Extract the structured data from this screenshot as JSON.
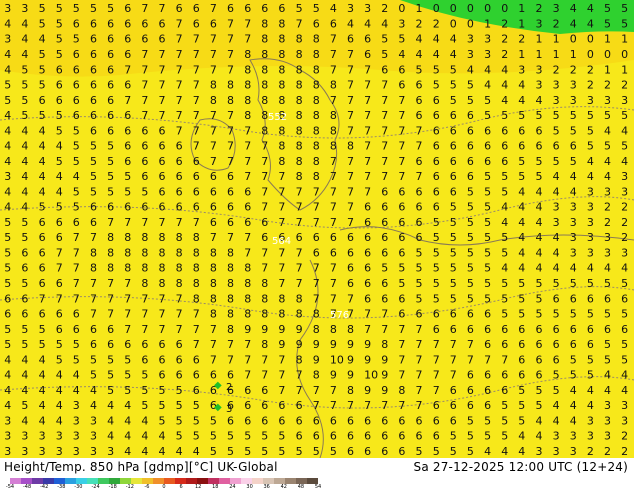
{
  "map": {
    "product": "Height/Temp. 850 hPa [gdmp][°C] UK-Global",
    "valid": "Sa 27-12-2025 12:00 UTC (12+24)",
    "field_colors": {
      "background": "#f7e81a",
      "upper_band": "#f6d615",
      "cold_edge": "#2fd12f",
      "label_text": "#111111",
      "contour": "#9a8a6a",
      "contour_alt": "#e0c7a0",
      "coast": "#8a7a55",
      "green_marker": "#1fbf2a"
    },
    "rows": [
      "3 3 5 5 5 5 5 6 7 7 6 6 7 6 6 6 6 5 5 4 3 3 2 0 1 0 0 0 0 0 1 2 3 4 4 5 5",
      "4 4 5 5 6 6 6 6 6 6 7 6 6 7 7 8 8 7 6 6 4 4 4 3 2 2 0 0 1 2 1 3 2 4 4 5 5",
      "3 4 4 5 5 6 6 6 6 6 7 7 7 7 7 8 8 8 8 7 6 6 5 5 4 4 4 3 3 2 2 1 1 0 0 1 1",
      "4 4 5 5 6 6 6 6 7 7 7 7 7 7 8 8 8 8 8 7 7 6 5 4 4 4 4 3 3 2 1 1 1 1 0 0 0",
      "4 5 5 6 6 6 6 7 7 7 7 7 7 7 8 8 8 8 8 7 7 7 6 6 5 5 5 4 4 4 3 3 2 2 2 1 1",
      "5 5 5 6 6 6 6 6 7 7 7 7 8 8 8 8 8 8 8 8 7 7 7 6 6 5 5 5 4 4 4 3 3 3 2 2 2",
      "5 5 6 6 6 6 6 7 7 7 7 7 8 8 8 8 8 8 8 7 7 7 7 7 6 6 5 5 5 4 4 4 3 3 3 3 3",
      "4 5 5 5 6 6 6 6 7 7 7 7 7 7 8 8 8 8 8 8 7 7 7 7 6 6 6 6 5 5 5 5 5 5 5 5 5",
      "4 4 4 5 5 6 6 6 6 6 7 7 7 7 7 8 8 8 8 8 7 7 7 7 7 6 6 6 6 6 6 6 5 5 5 4 4",
      "4 4 4 4 5 5 5 6 6 6 6 7 7 7 7 7 8 8 8 8 8 7 7 7 7 6 6 6 6 6 6 6 6 6 5 5 5",
      "4 4 4 5 5 5 5 6 6 6 6 6 7 7 7 7 8 8 8 7 7 7 7 7 6 6 6 6 6 6 5 5 5 5 4 4 4",
      "3 4 4 4 4 5 5 5 6 6 6 6 6 6 7 7 7 8 8 7 7 7 7 7 7 6 6 6 5 5 5 5 4 4 4 4 3",
      "4 4 4 4 5 5 5 5 5 6 6 6 6 6 6 7 7 7 7 7 7 7 6 6 6 6 6 5 5 5 4 4 4 4 3 3 3",
      "4 4 5 5 5 6 6 6 6 6 6 6 6 6 6 7 7 7 7 7 7 6 6 6 6 6 5 5 5 4 4 4 3 3 3 2 2",
      "5 5 6 6 6 6 7 7 7 7 7 7 6 6 6 6 7 7 7 7 7 6 6 6 6 5 5 5 5 4 4 4 3 3 3 2 2",
      "5 5 6 6 7 7 8 8 8 8 8 8 7 7 7 6 6 6 6 6 6 6 6 6 6 5 5 5 5 5 4 4 4 3 3 3 2",
      "5 6 6 7 7 8 8 8 8 8 8 8 8 8 7 7 7 7 6 6 6 6 6 6 5 5 5 5 5 5 4 4 4 3 3 3 3",
      "5 6 6 7 7 8 8 8 8 8 8 8 8 8 8 7 7 7 7 7 6 6 5 5 5 5 5 5 5 4 4 4 4 4 4 4 4",
      "5 5 6 6 7 7 7 7 8 8 8 8 8 8 8 8 7 7 7 7 6 6 6 5 5 5 5 5 5 5 5 5 5 5 5 5 5",
      "6 6 7 7 7 7 7 7 7 7 7 8 8 8 8 8 8 8 7 7 7 6 6 6 5 5 5 5 5 5 5 5 6 6 6 6 6",
      "6 6 6 6 6 7 7 7 7 7 7 7 8 8 8 8 8 8 8 7 7 7 7 6 6 6 6 6 6 5 5 5 5 5 5 5 5",
      "5 5 5 6 6 6 6 7 7 7 7 7 7 8 9 9 9 9 8 8 8 7 7 7 7 6 6 6 6 6 6 6 6 6 6 6 6",
      "5 5 5 5 5 6 6 6 6 6 6 7 7 7 7 8 9 9 9 9 9 9 8 7 7 7 7 7 6 6 6 6 6 6 6 5 5",
      "4 4 4 5 5 5 5 5 6 6 6 6 7 7 7 7 7 8 9 10 9 9 9 7 7 7 7 7 7 7 6 6 6 5 5 5 5",
      "4 4 4 4 4 5 5 5 5 6 6 6 6 6 7 7 7 7 8 9 9 10 9 7 7 7 7 6 6 6 6 6 5 5 5 4 4",
      "4 4 4 4 4 4 5 5 5 5 5 6 6 6 6 6 7 7 7 7 8 9 9 8 7 7 6 6 6 6 5 5 5 4 4 4 4",
      "4 5 4 4 3 4 4 4 5 5 5 5 6 6 6 6 6 6 7 7 7 7 7 7 7 6 6 6 6 5 5 5 4 4 4 3 3",
      "3 4 4 4 3 3 4 4 4 5 5 5 5 6 6 6 6 6 6 6 6 6 6 6 6 6 6 5 5 5 5 4 4 4 3 3 3",
      "3 3 3 3 3 3 4 4 4 4 5 5 5 5 5 5 5 6 6 6 6 6 6 6 6 6 5 5 5 5 4 4 3 3 3 3 2",
      "3 3 3 3 3 3 3 4 4 4 4 4 5 5 5 5 5 5 5 5 6 6 6 6 5 5 5 5 4 4 4 3 3 3 2 2 2"
    ],
    "contour_labels": [
      "552",
      "564",
      "576"
    ],
    "marker_labels": [
      "2",
      "3"
    ]
  },
  "footer": {
    "title_left": "Height/Temp. 850 hPa [gdmp][°C] UK-Global",
    "title_right": "Sa 27-12-2025 12:00 UTC (12+24)",
    "colorbar_colors": [
      "#d47fd4",
      "#a64fc8",
      "#6e3ba6",
      "#3a3aa8",
      "#1f5fd6",
      "#2aa0e0",
      "#39cfe6",
      "#45e0b8",
      "#3fc95f",
      "#2fa83a",
      "#8fd63a",
      "#e6e63a",
      "#f0c02a",
      "#f0902a",
      "#e85a20",
      "#d62a1a",
      "#b01a1a",
      "#8a1010",
      "#c03060",
      "#e060a0",
      "#f0a0d0",
      "#fad0e8",
      "#f4d2c8",
      "#d8c4b4",
      "#bda894",
      "#9a8470",
      "#7a6656",
      "#5a4a3c"
    ],
    "colorbar_ticks": [
      "-54",
      "-48",
      "-42",
      "-38",
      "-30",
      "-24",
      "-18",
      "-12",
      "-6",
      "0",
      "6",
      "12",
      "18",
      "24",
      "30",
      "36",
      "42",
      "48",
      "54"
    ]
  }
}
